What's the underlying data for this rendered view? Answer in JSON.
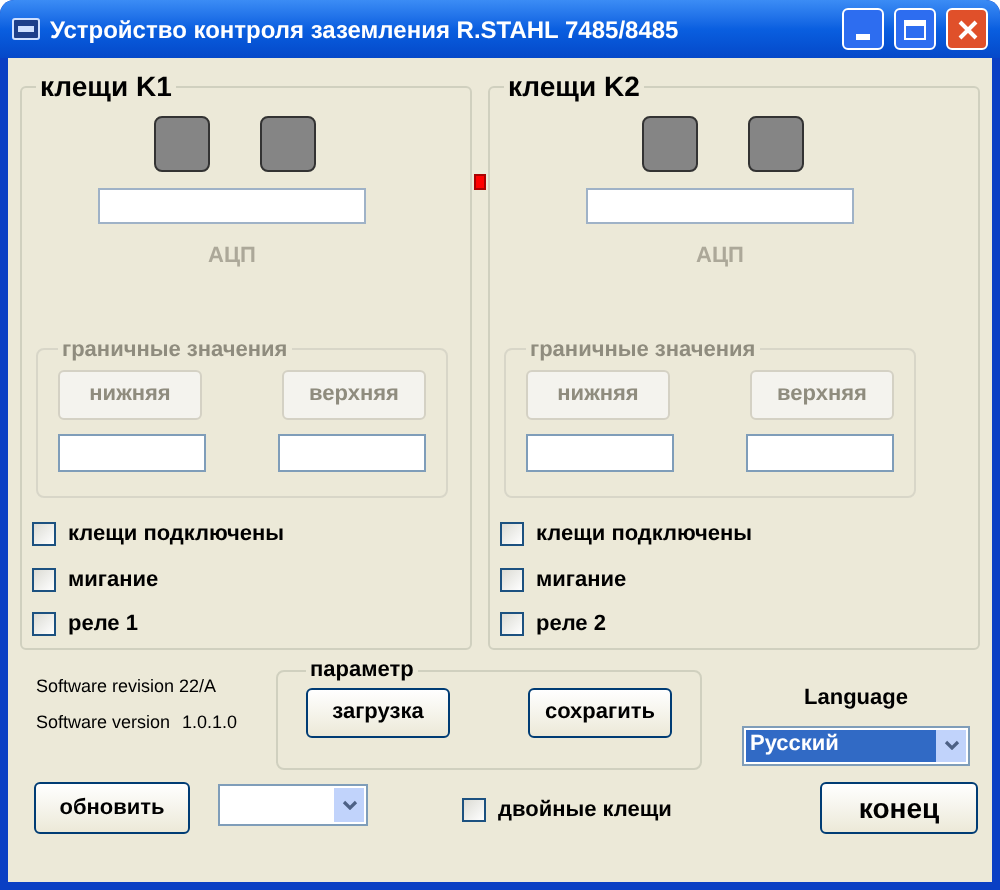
{
  "window": {
    "title": "Устройство контроля заземления R.STAHL 7485/8485"
  },
  "clamps": [
    {
      "title": "клещи K1",
      "adc_label": "АЦП",
      "limits": {
        "title": "граничные значения",
        "disabled": true,
        "buttons": [
          "нижняя",
          "верхняя"
        ]
      },
      "checkboxes": [
        {
          "label": "клещи подключены",
          "checked": false
        },
        {
          "label": "мигание",
          "checked": false
        },
        {
          "label": "реле 1",
          "checked": false
        }
      ]
    },
    {
      "title": "клещи K2",
      "adc_label": "АЦП",
      "limits": {
        "title": "граничные значения",
        "disabled": true,
        "buttons": [
          "нижняя",
          "верхняя"
        ]
      },
      "checkboxes": [
        {
          "label": "клещи подключены",
          "checked": false
        },
        {
          "label": "мигание",
          "checked": false
        },
        {
          "label": "реле 2",
          "checked": false
        }
      ]
    }
  ],
  "software": {
    "revision": "Software revision 22/A",
    "version_label": "Software version",
    "version": "1.0.1.0"
  },
  "parameter": {
    "title": "параметр",
    "buttons": [
      "загрузка",
      "сохрагить"
    ]
  },
  "language": {
    "label": "Language",
    "value": "Русский"
  },
  "refresh_button": "обновить",
  "double_clamps": {
    "label": "двойные клещи",
    "checked": false
  },
  "exit_button": "конец"
}
